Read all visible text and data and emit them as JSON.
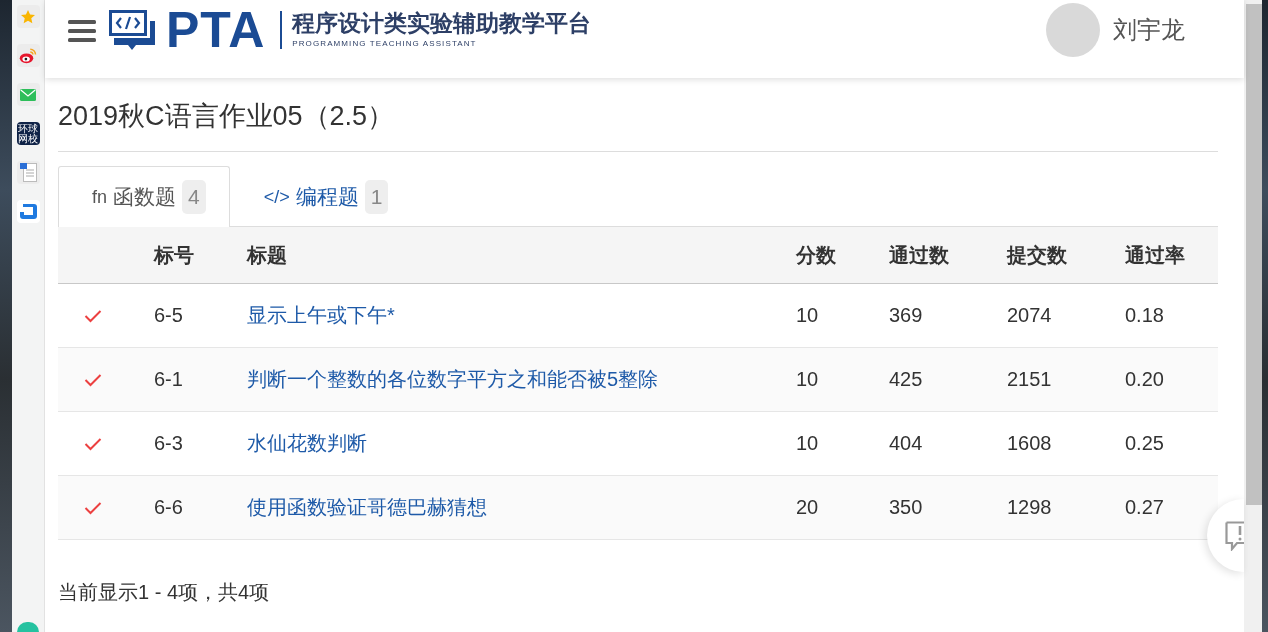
{
  "browser_sidebar": {
    "items": [
      {
        "kind": "star"
      },
      {
        "kind": "weibo"
      },
      {
        "kind": "mail"
      },
      {
        "kind": "text_tile",
        "text": "环球网校"
      },
      {
        "kind": "document"
      },
      {
        "kind": "app"
      }
    ]
  },
  "header": {
    "logo": {
      "wordmark": "PTA",
      "title": "程序设计类实验辅助教学平台",
      "subtitle": "PROGRAMMING TEACHING ASSISTANT"
    },
    "user": {
      "name": "刘宇龙"
    }
  },
  "page_title": "2019秋C语言作业05（2.5）",
  "tabs": [
    {
      "icon": "fn",
      "label": "函数题",
      "count": "4",
      "selected": true
    },
    {
      "icon": "</>",
      "label": "编程题",
      "count": "1",
      "selected": false
    }
  ],
  "table": {
    "columns": [
      "标号",
      "标题",
      "分数",
      "通过数",
      "提交数",
      "通过率"
    ],
    "rows": [
      {
        "passed": true,
        "id": "6-5",
        "title": "显示上午或下午*",
        "score": "10",
        "accepted": "369",
        "submitted": "2074",
        "rate": "0.18"
      },
      {
        "passed": true,
        "id": "6-1",
        "title": "判断一个整数的各位数字平方之和能否被5整除",
        "score": "10",
        "accepted": "425",
        "submitted": "2151",
        "rate": "0.20"
      },
      {
        "passed": true,
        "id": "6-3",
        "title": "水仙花数判断",
        "score": "10",
        "accepted": "404",
        "submitted": "1608",
        "rate": "0.25"
      },
      {
        "passed": true,
        "id": "6-6",
        "title": "使用函数验证哥德巴赫猜想",
        "score": "20",
        "accepted": "350",
        "submitted": "1298",
        "rate": "0.27"
      }
    ]
  },
  "footer": "当前显示1 - 4项，共4项"
}
